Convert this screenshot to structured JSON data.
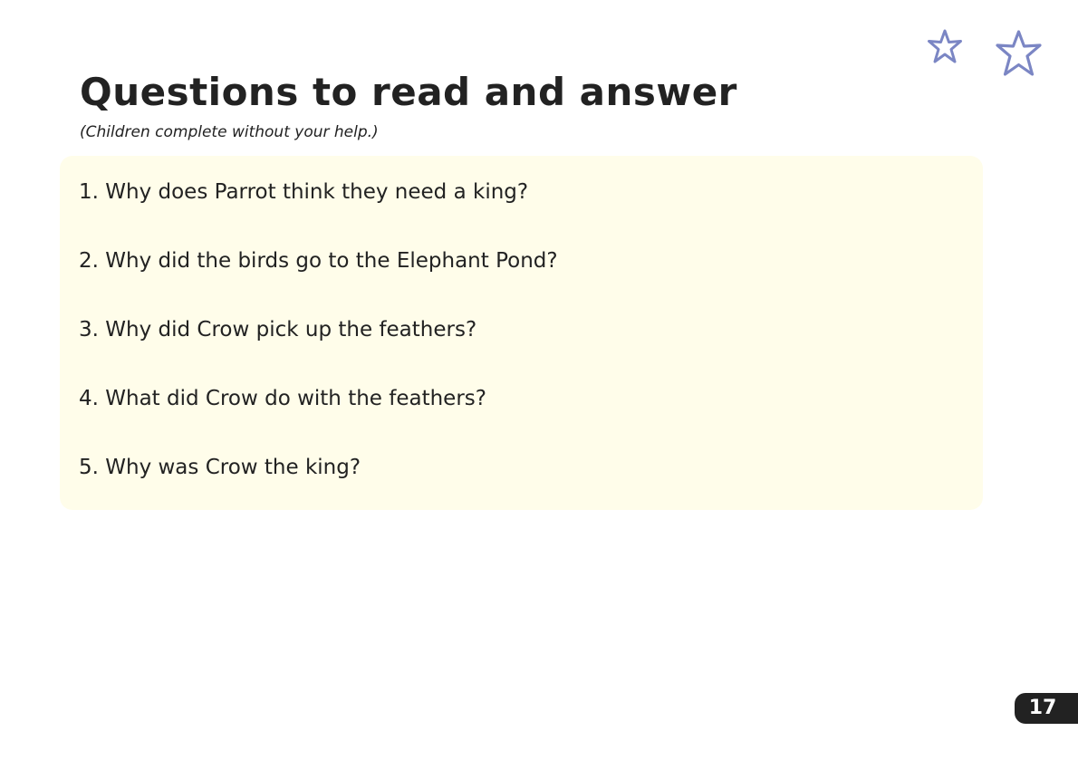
{
  "header": {
    "title": "Questions to read and answer",
    "subtitle": "(Children complete without your help.)"
  },
  "questions": [
    {
      "label": "1. Why does Parrot think they need a king?"
    },
    {
      "label": "2. Why did the birds go to the Elephant Pond?"
    },
    {
      "label": "3. Why did Crow pick up the feathers?"
    },
    {
      "label": "4. What did Crow do with the feathers?"
    },
    {
      "label": "5. Why was Crow the king?"
    }
  ],
  "decorations": {
    "icons": [
      "star-outline-icon",
      "star-outline-icon"
    ],
    "star_color": "#7b86c4",
    "box_color": "#fffdea"
  },
  "footer": {
    "page_number": "17"
  }
}
